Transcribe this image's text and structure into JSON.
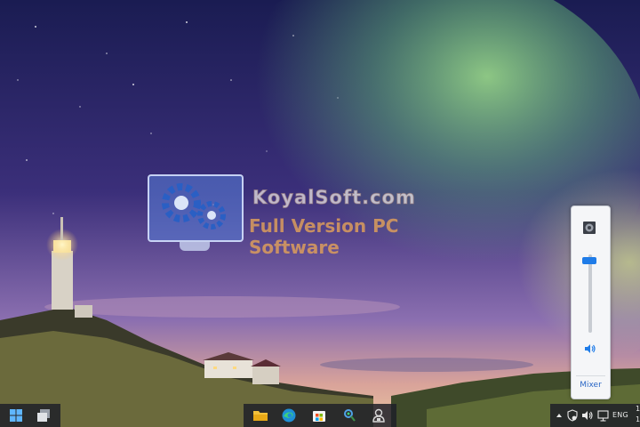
{
  "watermark": {
    "title": "KoyalSoft.com",
    "subtitle": "Full Version PC Software"
  },
  "volume_flyout": {
    "device_icon": "speaker-device-icon",
    "level": 0.92,
    "speaker_icon": "speaker-volume-icon",
    "mixer_label": "Mixer"
  },
  "taskbar": {
    "left_icons": [
      "start-icon",
      "task-view-icon"
    ],
    "pinned_icons": [
      "file-explorer-icon",
      "edge-browser-icon",
      "store-icon",
      "search-app-icon",
      "user-app-icon"
    ],
    "tray": {
      "chevron_icon": "show-hidden-icons-icon",
      "icons": [
        "security-icon",
        "volume-icon",
        "network-icon"
      ],
      "language": "ENG",
      "clock_time": "1",
      "clock_date": "1("
    }
  },
  "colors": {
    "accent": "#1f7ce8",
    "taskbar_bg": "#1e2028",
    "panel_bg": "#f5f6f8"
  }
}
